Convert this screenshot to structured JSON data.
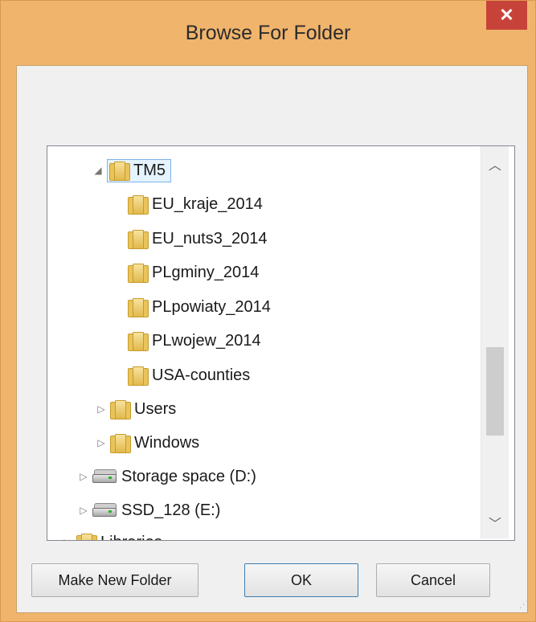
{
  "window": {
    "title": "Browse For Folder",
    "close_label": "✕"
  },
  "tree": {
    "items": [
      {
        "label": "TM5",
        "type": "folder",
        "expander": "◢",
        "selected": true
      },
      {
        "label": "EU_kraje_2014",
        "type": "folder"
      },
      {
        "label": "EU_nuts3_2014",
        "type": "folder"
      },
      {
        "label": "PLgminy_2014",
        "type": "folder"
      },
      {
        "label": "PLpowiaty_2014",
        "type": "folder"
      },
      {
        "label": "PLwojew_2014",
        "type": "folder"
      },
      {
        "label": "USA-counties",
        "type": "folder"
      },
      {
        "label": "Users",
        "type": "folder",
        "expander": "▷"
      },
      {
        "label": "Windows",
        "type": "folder",
        "expander": "▷"
      },
      {
        "label": "Storage space (D:)",
        "type": "drive",
        "expander": "▷"
      },
      {
        "label": "SSD_128 (E:)",
        "type": "drive",
        "expander": "▷"
      },
      {
        "label": "Libraries",
        "type": "library",
        "expander": "▷"
      }
    ]
  },
  "scrollbar": {
    "up_arrow": "︿",
    "down_arrow": "﹀"
  },
  "buttons": {
    "make_new_folder": "Make New Folder",
    "ok": "OK",
    "cancel": "Cancel"
  },
  "colors": {
    "frame": "#f0b46c",
    "close": "#c7433a",
    "selection": "#e5f3ff"
  }
}
